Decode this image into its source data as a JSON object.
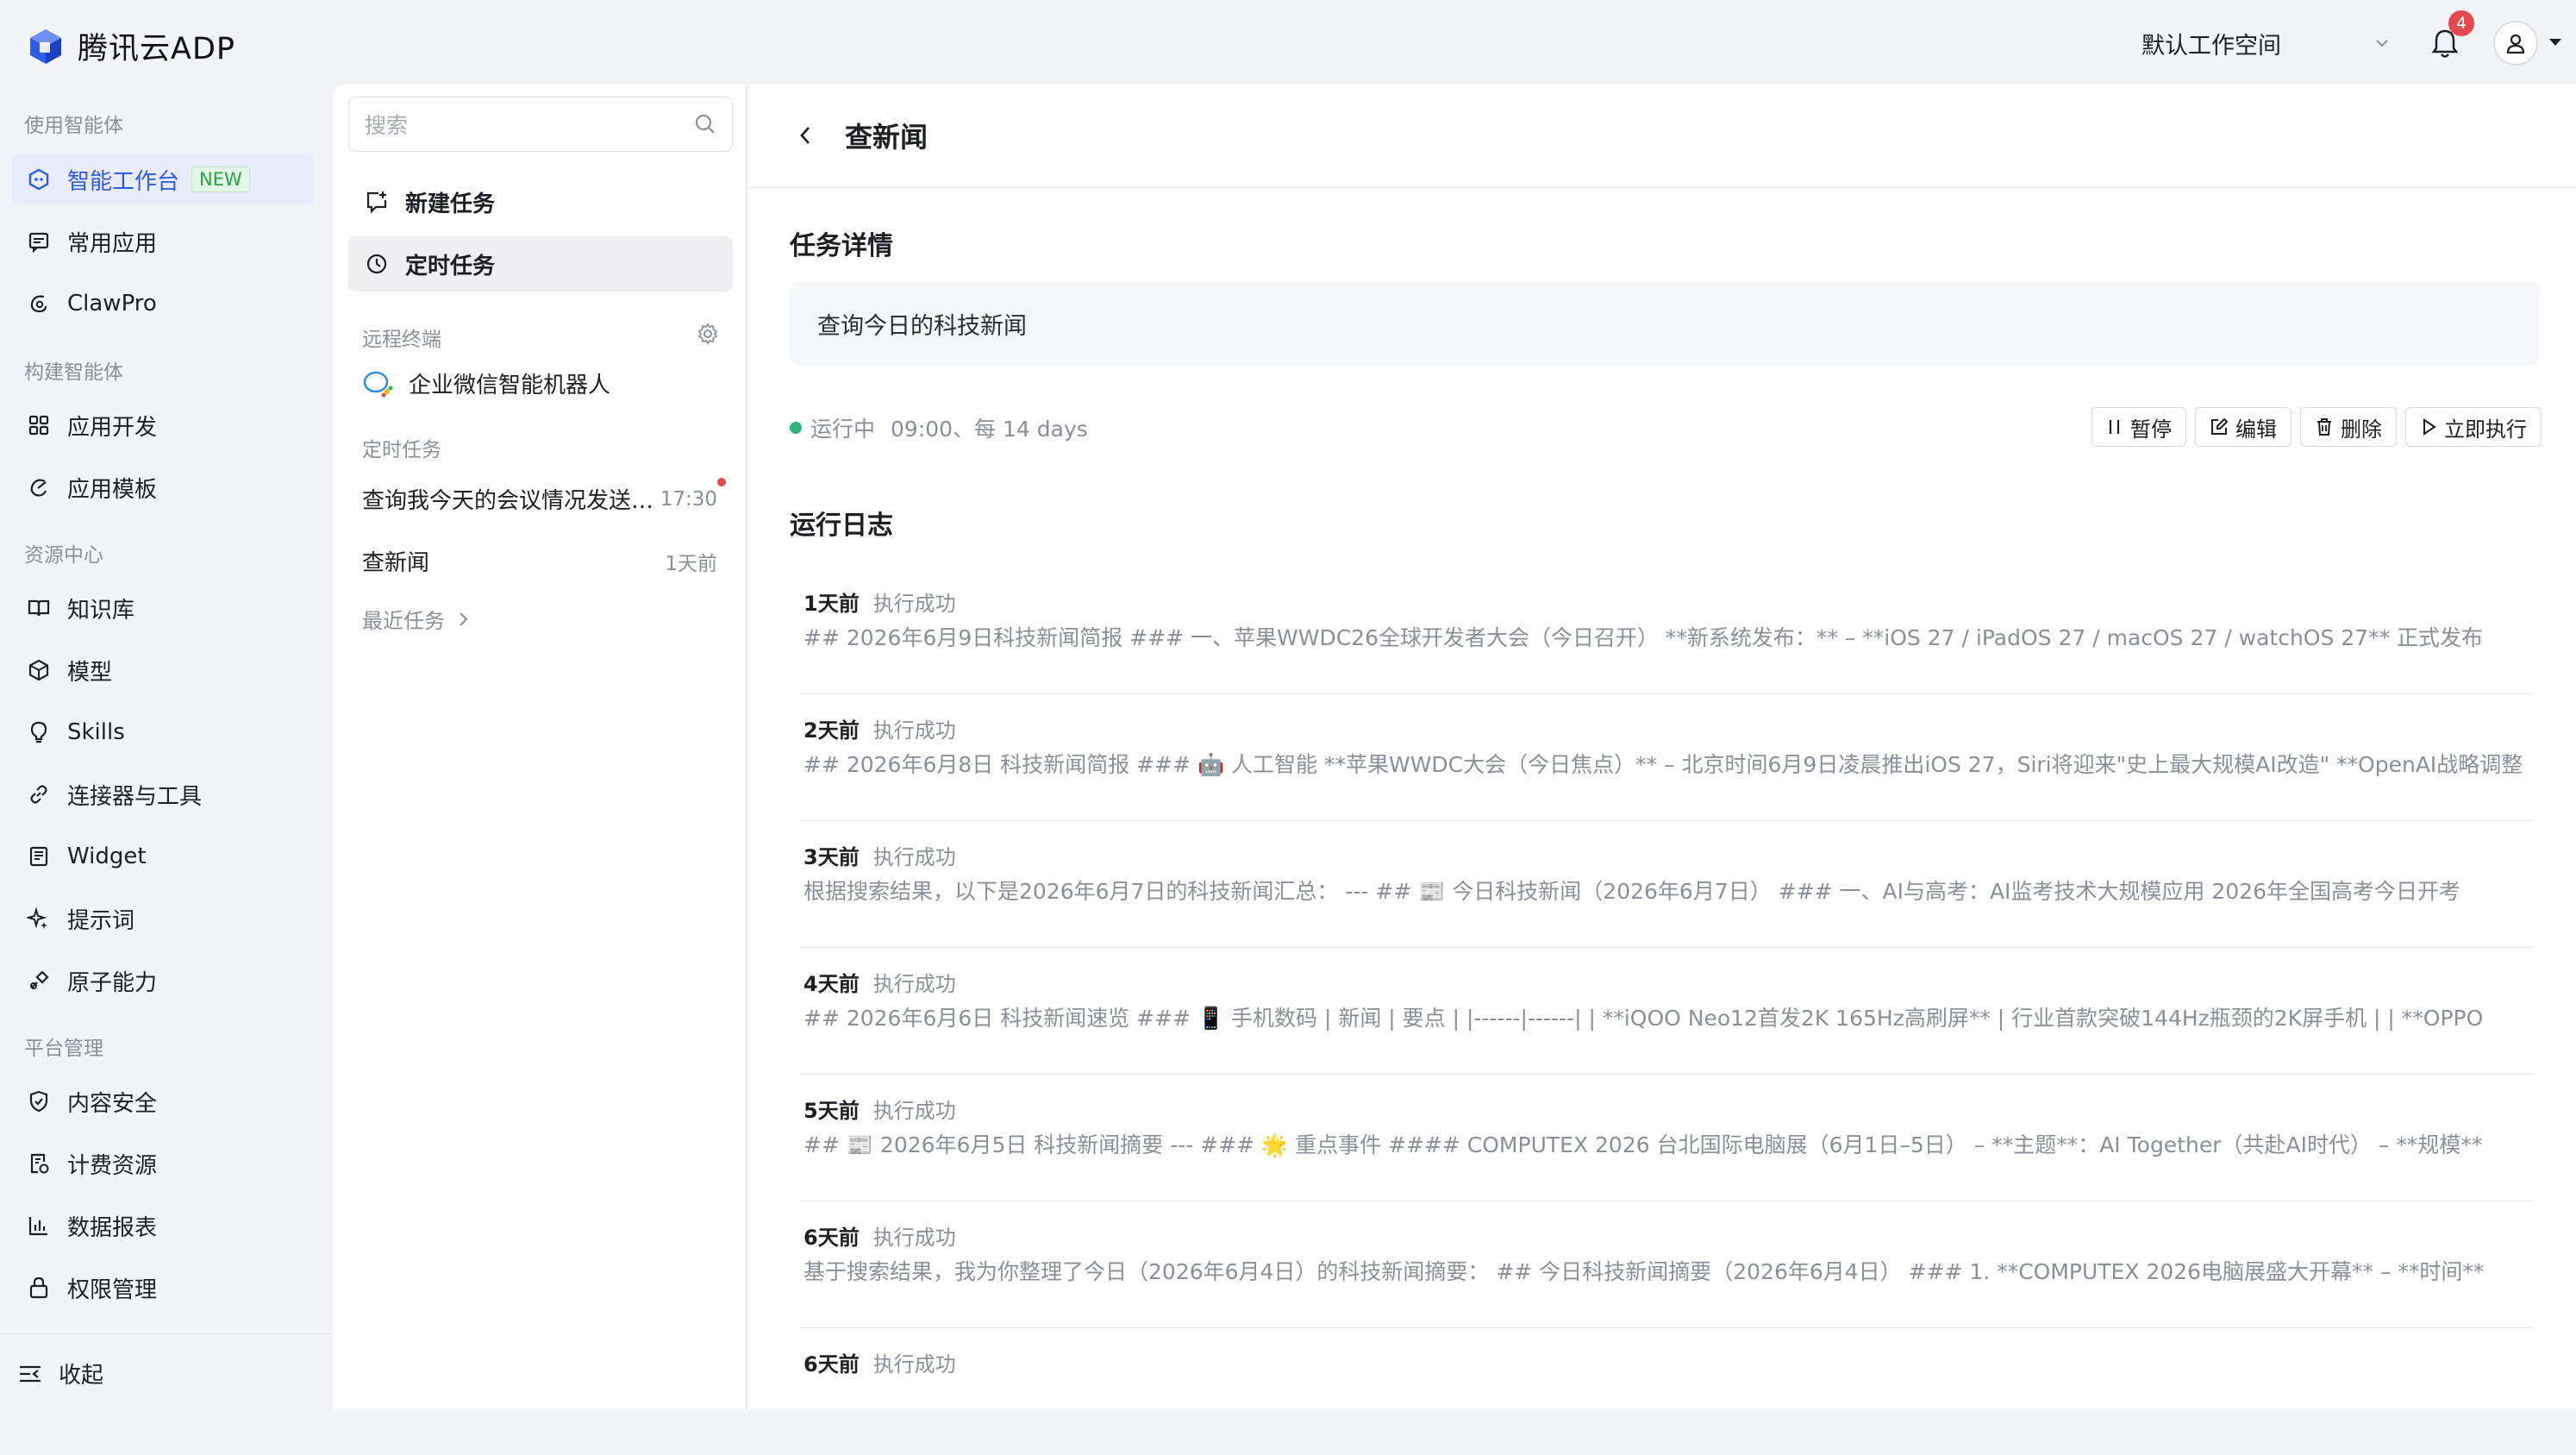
{
  "app": {
    "name": "腾讯云ADP"
  },
  "header": {
    "workspace": "默认工作空间",
    "notification_count": "4"
  },
  "sidebar": {
    "sections": [
      "使用智能体",
      "构建智能体",
      "资源中心",
      "平台管理"
    ],
    "items": [
      {
        "label": "智能工作台",
        "tag": "NEW",
        "icon": "bot-icon"
      },
      {
        "label": "常用应用",
        "icon": "message-icon"
      },
      {
        "label": "ClawPro",
        "icon": "claw-icon"
      },
      {
        "label": "应用开发",
        "icon": "grid-icon"
      },
      {
        "label": "应用模板",
        "icon": "template-icon"
      },
      {
        "label": "知识库",
        "icon": "book-icon"
      },
      {
        "label": "模型",
        "icon": "cube-icon"
      },
      {
        "label": "Skills",
        "icon": "bulb-icon"
      },
      {
        "label": "连接器与工具",
        "icon": "link-icon"
      },
      {
        "label": "Widget",
        "icon": "widget-icon"
      },
      {
        "label": "提示词",
        "icon": "sparkle-icon"
      },
      {
        "label": "原子能力",
        "icon": "atom-icon"
      },
      {
        "label": "内容安全",
        "icon": "shield-icon"
      },
      {
        "label": "计费资源",
        "icon": "billing-icon"
      },
      {
        "label": "数据报表",
        "icon": "chart-icon"
      },
      {
        "label": "权限管理",
        "icon": "lock-icon"
      }
    ],
    "collapse": "收起"
  },
  "mid": {
    "search_placeholder": "搜索",
    "new_task": "新建任务",
    "scheduled_task": "定时任务",
    "remote_section": "远程终端",
    "bot": "企业微信智能机器人",
    "task_section": "定时任务",
    "tasks": [
      {
        "title": "查询我今天的会议情况发送给我",
        "time": "17:30"
      },
      {
        "title": "查新闻",
        "time": "1天前"
      }
    ],
    "recent": "最近任务"
  },
  "main": {
    "title": "查新闻",
    "detail_heading": "任务详情",
    "detail_text": "查询今日的科技新闻",
    "status": "运行中",
    "schedule": "09:00、每 14 days",
    "buttons": {
      "pause": "暂停",
      "edit": "编辑",
      "delete": "删除",
      "run": "立即执行"
    },
    "log_heading": "运行日志",
    "logs": [
      {
        "when": "1天前",
        "result": "执行成功",
        "body": "## 2026年6月9日科技新闻简报 ### 一、苹果WWDC26全球开发者大会（今日召开） **新系统发布：** – **iOS 27 / iPadOS 27 / macOS 27 / watchOS 27** 正式发布"
      },
      {
        "when": "2天前",
        "result": "执行成功",
        "body": "## 2026年6月8日 科技新闻简报 ### 🤖 人工智能 **苹果WWDC大会（今日焦点）** – 北京时间6月9日凌晨推出iOS 27，Siri将迎来\"史上最大规模AI改造\" **OpenAI战略调整"
      },
      {
        "when": "3天前",
        "result": "执行成功",
        "body": "根据搜索结果，以下是2026年6月7日的科技新闻汇总： --- ## 📰 今日科技新闻（2026年6月7日） ### 一、AI与高考：AI监考技术大规模应用 2026年全国高考今日开考"
      },
      {
        "when": "4天前",
        "result": "执行成功",
        "body": "## 2026年6月6日 科技新闻速览 ### 📱 手机数码 | 新闻 | 要点 | |------|------| | **iQOO Neo12首发2K 165Hz高刷屏** | 行业首款突破144Hz瓶颈的2K屏手机 | | **OPPO"
      },
      {
        "when": "5天前",
        "result": "执行成功",
        "body": "## 📰 2026年6月5日 科技新闻摘要 --- ### 🌟 重点事件 #### COMPUTEX 2026 台北国际电脑展（6月1日–5日） – **主题**：AI Together（共赴AI时代） – **规模**"
      },
      {
        "when": "6天前",
        "result": "执行成功",
        "body": "基于搜索结果，我为你整理了今日（2026年6月4日）的科技新闻摘要： ## 今日科技新闻摘要（2026年6月4日） ### 1. **COMPUTEX 2026电脑展盛大开幕** – **时间**"
      },
      {
        "when": "6天前",
        "result": "执行成功",
        "body": ""
      }
    ]
  }
}
